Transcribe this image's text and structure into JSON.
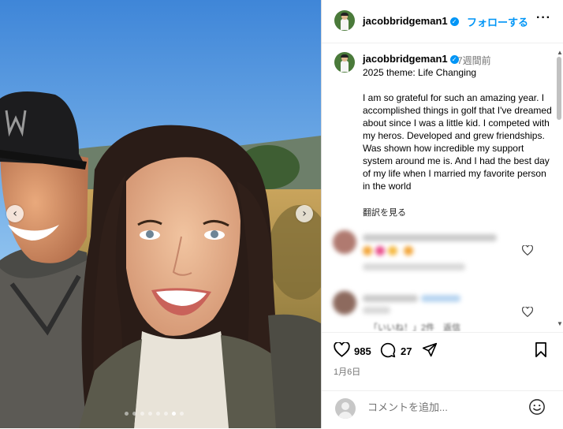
{
  "header": {
    "username": "jacobbridgeman1",
    "follow_label": "フォローする",
    "more_label": "···"
  },
  "caption": {
    "username": "jacobbridgeman1",
    "time_ago": "7週間前",
    "text": "2025 theme: Life Changing\n\nI am so grateful for such an amazing year. I accomplished things in golf that I've dreamed about since I was a little kid. I competed with my heros. Developed and grew friendships. Was shown how incredible my support system around me is. And I had the best day of my life when I married my favorite person in the world",
    "translate_label": "翻訳を見る"
  },
  "comments": [
    {
      "username": "hidden_user_1",
      "text": "😍😍😍😍",
      "meta": "7週間前 返信",
      "blurred": true
    },
    {
      "username": "hidden_user_2",
      "text": "hidden",
      "meta": "「いいね！」2件　返信",
      "blurred": true
    }
  ],
  "actions": {
    "like_count": "985",
    "comment_count": "27",
    "icons": [
      "heart-icon",
      "comment-icon",
      "share-icon",
      "bookmark-icon"
    ]
  },
  "post_date": "1月6日",
  "add_comment": {
    "placeholder": "コメントを追加..."
  },
  "carousel": {
    "prev_icon": "chevron-left-icon",
    "next_icon": "chevron-right-icon",
    "dot_count": 8,
    "active_index": 6
  },
  "colors": {
    "accent": "#0095f6",
    "verified": "#0095f6",
    "meta_gray": "#737373"
  }
}
